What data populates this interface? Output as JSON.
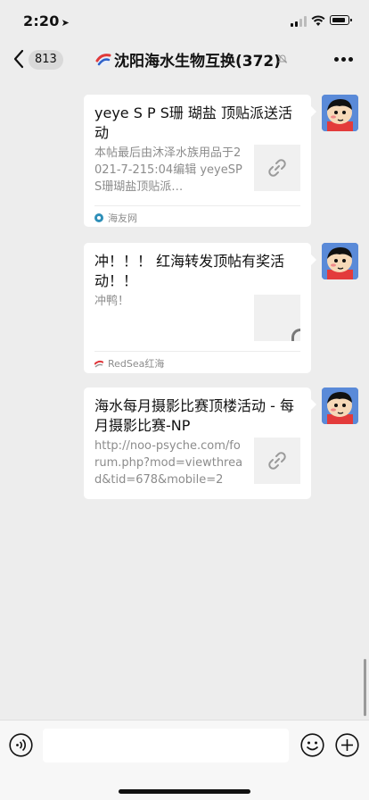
{
  "status_bar": {
    "time": "2:20",
    "location_arrow": "➤"
  },
  "nav": {
    "unread_count": "813",
    "title": "沈阳海水生物互换(372)",
    "icons": [
      "chevron-left-icon",
      "group-logo-icon",
      "mute-bell-icon",
      "more-dots-icon"
    ]
  },
  "messages": [
    {
      "title": "yeye S P S珊 瑚盐 顶贴派送活动",
      "description": "本帖最后由沐泽水族用品于2021-7-215:04编辑 yeyeSPS珊瑚盐顶贴派…",
      "thumbnail": "link-icon",
      "source": "海友网"
    },
    {
      "title": "冲！！！ 红海转发顶帖有奖活动！！",
      "description": "冲鸭！",
      "thumbnail": "image-thumbnail",
      "source": "RedSea红海"
    },
    {
      "title": "海水每月摄影比赛顶楼活动 - 每月摄影比赛-NP",
      "description": "http://noo-psyche.com/forum.php?mod=viewthread&tid=678&mobile=2",
      "thumbnail": "link-icon",
      "source": ""
    }
  ],
  "input_bar": {
    "placeholder": "",
    "icons": [
      "voice-icon",
      "emoji-icon",
      "plus-icon"
    ]
  },
  "colors": {
    "background": "#ededed",
    "card": "#ffffff",
    "secondary_text": "#8c8c8c",
    "avatar_bg": "#5a8ad8"
  }
}
